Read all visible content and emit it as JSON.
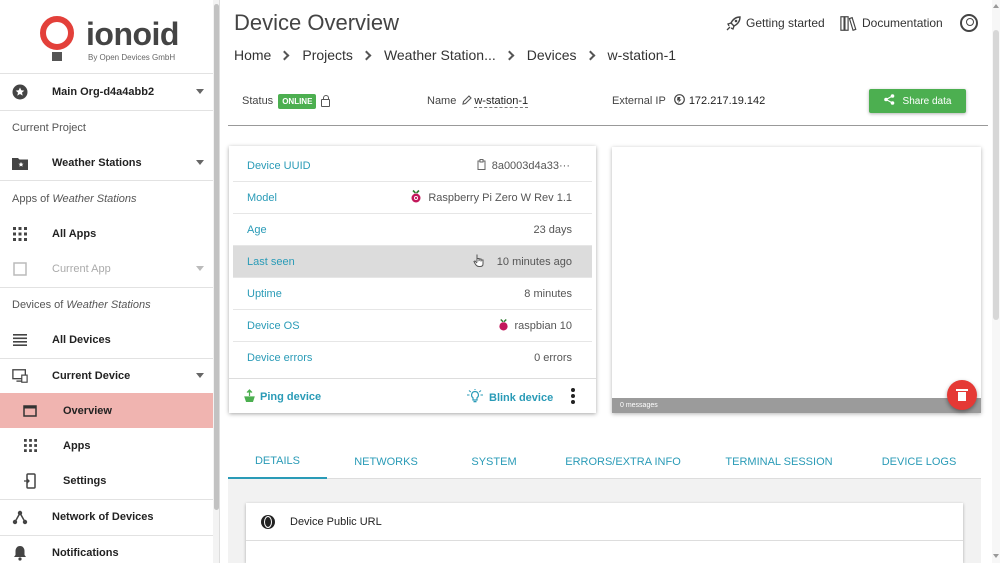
{
  "brand": {
    "name": "ionoid",
    "tagline": "By Open Devices GmbH"
  },
  "sidebar": {
    "org": "Main Org-d4a4abb2",
    "current_project_label": "Current Project",
    "project": "Weather Stations",
    "apps_of_prefix": "Apps of ",
    "apps_of_name": "Weather Stations",
    "all_apps": "All Apps",
    "current_app": "Current App",
    "devices_of_prefix": "Devices of ",
    "devices_of_name": "Weather Stations",
    "all_devices": "All Devices",
    "current_device": "Current Device",
    "overview": "Overview",
    "apps": "Apps",
    "settings": "Settings",
    "network": "Network of Devices",
    "notifications": "Notifications"
  },
  "header": {
    "title": "Device Overview",
    "getting_started": "Getting started",
    "documentation": "Documentation",
    "breadcrumb": [
      "Home",
      "Projects",
      "Weather Station...",
      "Devices",
      "w-station-1"
    ]
  },
  "status_bar": {
    "status_label": "Status",
    "status_value": "ONLINE",
    "name_label": "Name",
    "name_value": "w-station-1",
    "ip_label": "External IP",
    "ip_value": "172.217.19.142",
    "share_label": "Share data"
  },
  "device_info": [
    {
      "key": "Device UUID",
      "value": "8a0003d4a33···"
    },
    {
      "key": "Model",
      "value": "Raspberry Pi Zero W Rev 1.1"
    },
    {
      "key": "Age",
      "value": "23 days"
    },
    {
      "key": "Last seen",
      "value": "10 minutes ago"
    },
    {
      "key": "Uptime",
      "value": "8 minutes"
    },
    {
      "key": "Device OS",
      "value": "raspbian 10"
    },
    {
      "key": "Device errors",
      "value": "0 errors"
    }
  ],
  "actions": {
    "ping": "Ping device",
    "blink": "Blink device"
  },
  "console": {
    "messages": "0 messages"
  },
  "tabs": [
    "DETAILS",
    "NETWORKS",
    "SYSTEM",
    "ERRORS/EXTRA INFO",
    "TERMINAL SESSION",
    "DEVICE LOGS"
  ],
  "public_url": {
    "title": "Device Public URL"
  },
  "colors": {
    "accent": "#2a9bb7",
    "online": "#4caf50",
    "brand": "#e3403a",
    "active_nav": "#f0b4b0",
    "danger": "#e53935"
  }
}
